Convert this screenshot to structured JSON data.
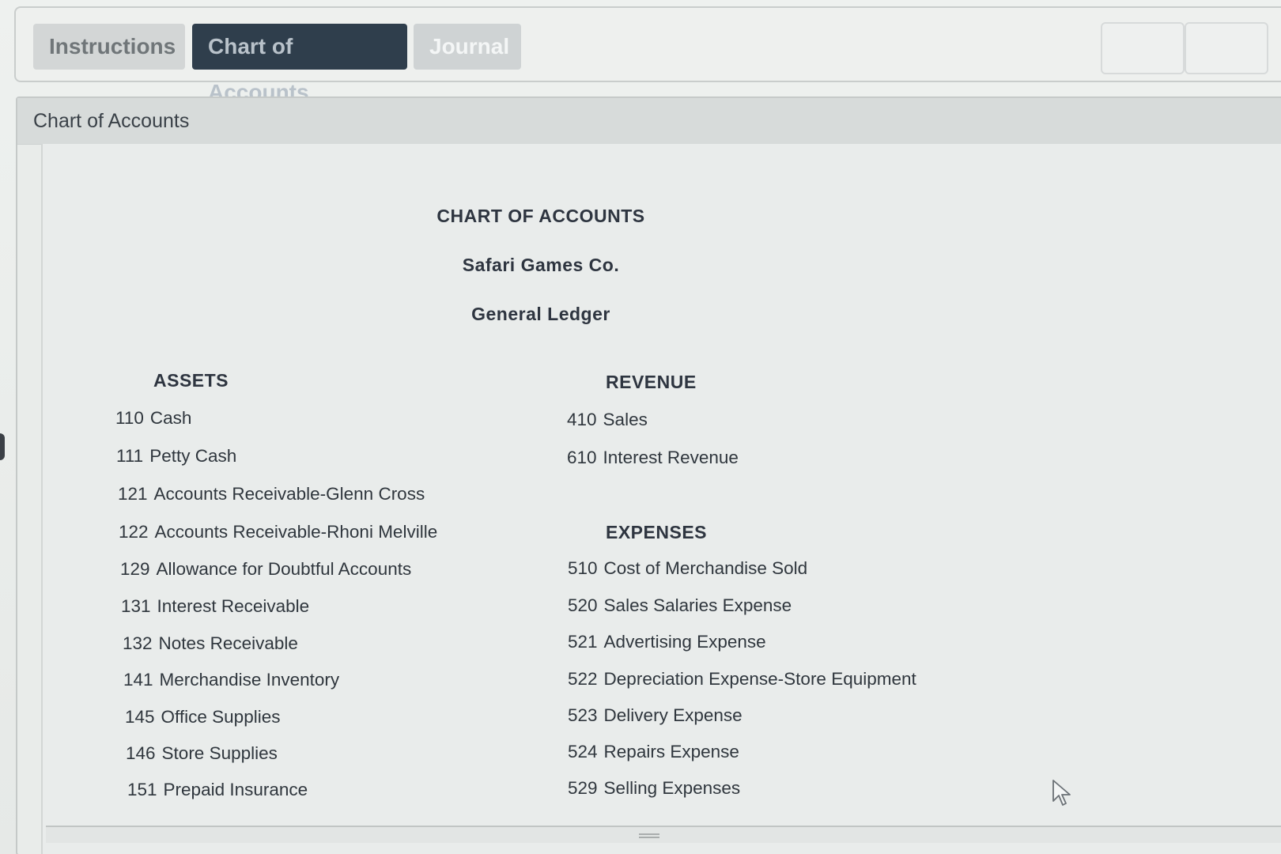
{
  "tabs": {
    "instructions": "Instructions",
    "chart_of_accounts": "Chart of Accounts",
    "journal": "Journal"
  },
  "panel": {
    "title": "Chart of Accounts"
  },
  "document": {
    "heading": "CHART OF ACCOUNTS",
    "company": "Safari Games Co.",
    "ledger": "General Ledger"
  },
  "assets": {
    "title": "ASSETS",
    "accounts": [
      {
        "number": "110",
        "name": "Cash"
      },
      {
        "number": "111",
        "name": "Petty Cash"
      },
      {
        "number": "121",
        "name": "Accounts Receivable-Glenn Cross"
      },
      {
        "number": "122",
        "name": "Accounts Receivable-Rhoni Melville"
      },
      {
        "number": "129",
        "name": "Allowance for Doubtful Accounts"
      },
      {
        "number": "131",
        "name": "Interest Receivable"
      },
      {
        "number": "132",
        "name": "Notes Receivable"
      },
      {
        "number": "141",
        "name": "Merchandise Inventory"
      },
      {
        "number": "145",
        "name": "Office Supplies"
      },
      {
        "number": "146",
        "name": "Store Supplies"
      },
      {
        "number": "151",
        "name": "Prepaid Insurance"
      }
    ]
  },
  "revenue": {
    "title": "REVENUE",
    "accounts": [
      {
        "number": "410",
        "name": "Sales"
      },
      {
        "number": "610",
        "name": "Interest Revenue"
      }
    ]
  },
  "expenses": {
    "title": "EXPENSES",
    "accounts": [
      {
        "number": "510",
        "name": "Cost of Merchandise Sold"
      },
      {
        "number": "520",
        "name": "Sales Salaries Expense"
      },
      {
        "number": "521",
        "name": "Advertising Expense"
      },
      {
        "number": "522",
        "name": "Depreciation Expense-Store Equipment"
      },
      {
        "number": "523",
        "name": "Delivery Expense"
      },
      {
        "number": "524",
        "name": "Repairs Expense"
      },
      {
        "number": "529",
        "name": "Selling Expenses"
      }
    ]
  },
  "colors": {
    "active_tab": "#2f3e4c",
    "inactive_tab": "#d3d6d6",
    "background": "#e9ecea"
  },
  "icons": {
    "cursor": "arrow-cursor-icon",
    "resize": "resize-grip-icon"
  }
}
